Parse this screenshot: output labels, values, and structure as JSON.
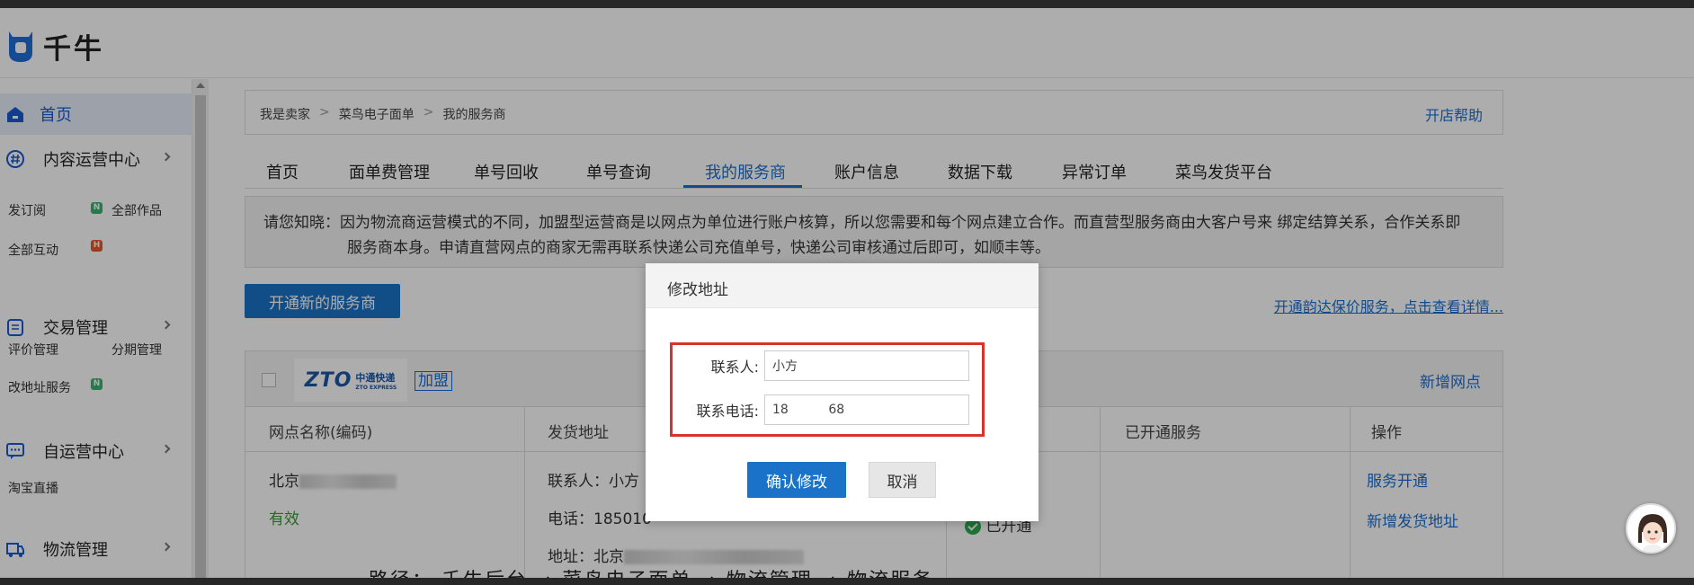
{
  "app": {
    "logo_text": "千牛"
  },
  "sidebar": {
    "home": "首页",
    "content_center": {
      "title": "内容运营中心",
      "items": [
        "发订阅",
        "全部作品",
        "全部互动"
      ]
    },
    "trade": {
      "title": "交易管理",
      "items": [
        "评价管理",
        "分期管理",
        "改地址服务"
      ]
    },
    "self_op": {
      "title": "自运营中心",
      "items": [
        "淘宝直播"
      ]
    },
    "logistics": {
      "title": "物流管理"
    },
    "badges": {
      "n": "N",
      "h": "H"
    }
  },
  "breadcrumb": {
    "items": [
      "我是卖家",
      "菜鸟电子面单",
      "我的服务商"
    ],
    "sep": ">",
    "help": "开店帮助"
  },
  "tabs": [
    "首页",
    "面单费管理",
    "单号回收",
    "单号查询",
    "我的服务商",
    "账户信息",
    "数据下载",
    "异常订单",
    "菜鸟发货平台"
  ],
  "active_tab": 4,
  "notice": {
    "line1": "请您知晓：因为物流商运营模式的不同，加盟型运营商是以网点为单位进行账户核算，所以您需要和每个网点建立合作。而直营型服务商由大客户号来 绑定结算关系，合作关系即",
    "line2": "服务商本身。申请直营网点的商家无需再联系快递公司充值单号，快递公司审核通过后即可，如顺丰等。"
  },
  "open_button": "开通新的服务商",
  "insurance_link": "开通韵达保价服务，点击查看详情...",
  "carrier": {
    "logo_main": "ZTO",
    "logo_cn": "中通快递",
    "logo_en": "ZTO EXPRESS",
    "type": "加盟",
    "add_point": "新增网点",
    "columns": [
      "网点名称(编码)",
      "发货地址",
      "已开通服务",
      "操作"
    ],
    "row": {
      "name": "北京",
      "status": "有效",
      "contact": "联系人：小方",
      "phone": "电话：185010",
      "address": "地址：北京",
      "service_status": "已开通",
      "actions": [
        "服务开通",
        "新增发货地址"
      ]
    }
  },
  "modal": {
    "title": "修改地址",
    "contact_label": "联系人:",
    "contact_value": "小方",
    "phone_label": "联系电话:",
    "phone_value": "18          68",
    "confirm": "确认修改",
    "cancel": "取消"
  },
  "bottom_text": "路径： 千牛后台 → 菜鸟电子面单 → 物流管理 → 物流服务"
}
